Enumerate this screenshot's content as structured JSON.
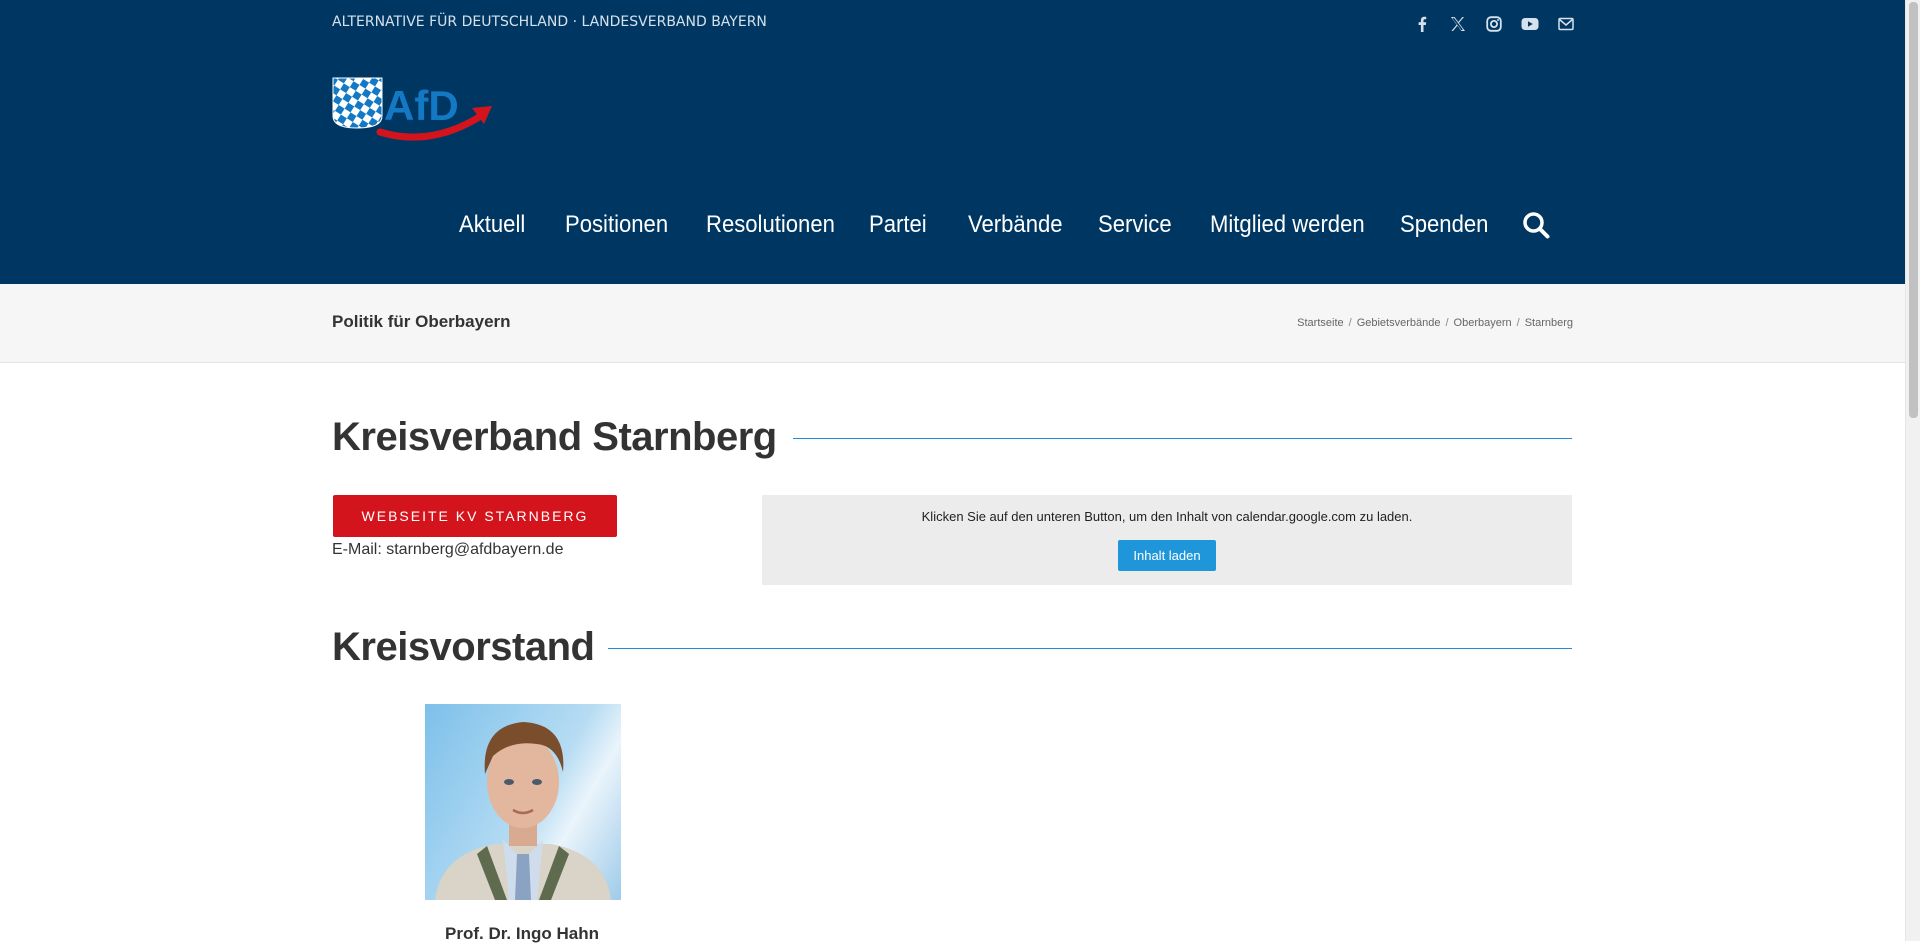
{
  "header": {
    "tagline": "ALTERNATIVE FÜR DEUTSCHLAND · LANDESVERBAND BAYERN",
    "logo_text": "AfD",
    "social": [
      "facebook-icon",
      "x-icon",
      "instagram-icon",
      "youtube-icon",
      "mail-icon"
    ]
  },
  "nav": {
    "items": [
      "Aktuell",
      "Positionen",
      "Resolutionen",
      "Partei",
      "Verbände",
      "Service",
      "Mitglied werden",
      "Spenden"
    ],
    "search_icon": "search-icon"
  },
  "titlebar": {
    "title": "Politik für Oberbayern",
    "breadcrumbs": [
      "Startseite",
      "Gebietsverbände",
      "Oberbayern",
      "Starnberg"
    ],
    "separator": "/"
  },
  "main": {
    "heading": "Kreisverband Starnberg",
    "website_button": "WEBSEITE KV STARNBERG",
    "email_label": "E-Mail:",
    "email": "starnberg@afdbayern.de",
    "calendar": {
      "message": "Klicken Sie auf den unteren Button, um den Inhalt von calendar.google.com zu laden.",
      "button": "Inhalt laden"
    },
    "board_heading": "Kreisvorstand",
    "member_name": "Prof. Dr. Ingo Hahn"
  },
  "colors": {
    "header_bg": "#003762",
    "accent_red": "#d4141c",
    "accent_blue": "#1e96d9",
    "rule_blue": "#1a8fd6"
  }
}
